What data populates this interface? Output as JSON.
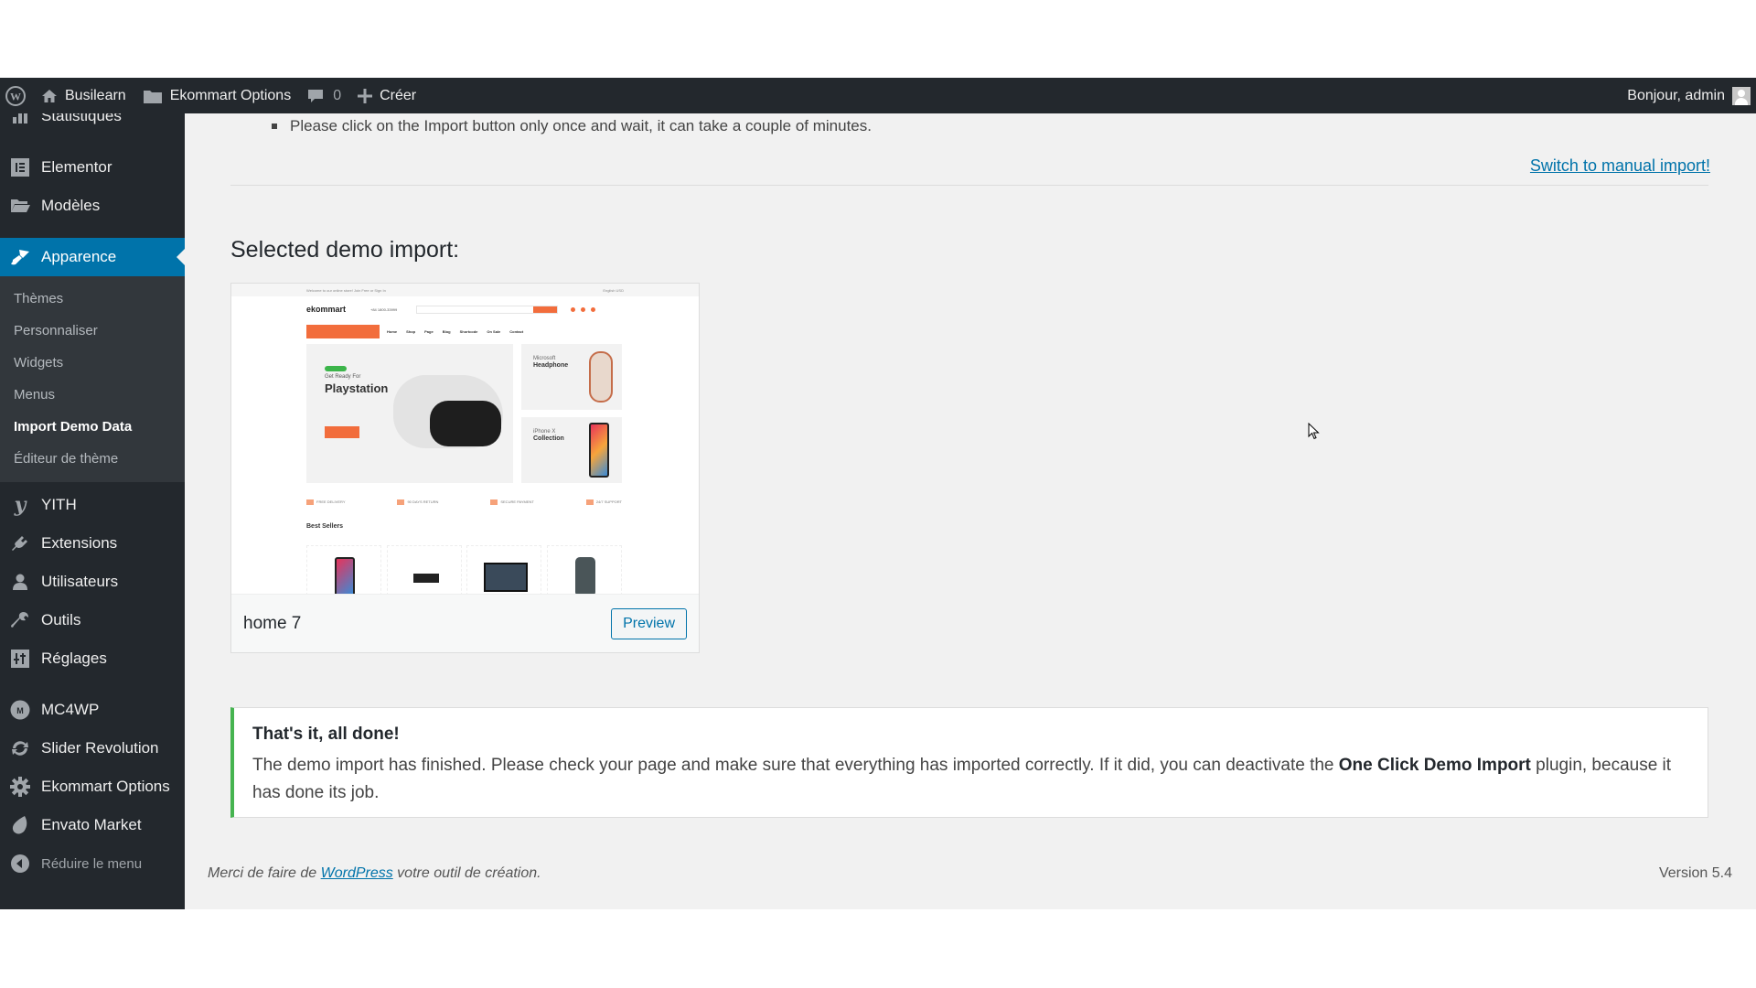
{
  "admin_bar": {
    "wp_logo_icon": "wordpress-logo-icon",
    "site_name": "Busilearn",
    "options_label": "Ekommart Options",
    "comments_count": "0",
    "new_label": "Créer",
    "greeting": "Bonjour, admin"
  },
  "sidebar": {
    "items_top": [
      {
        "label": "Statistiques",
        "icon": "stats-icon"
      },
      {
        "label": "Elementor",
        "icon": "elementor-icon"
      },
      {
        "label": "Modèles",
        "icon": "folder-icon"
      }
    ],
    "current": {
      "label": "Apparence",
      "icon": "brush-icon"
    },
    "submenu": [
      {
        "label": "Thèmes",
        "active": false
      },
      {
        "label": "Personnaliser",
        "active": false
      },
      {
        "label": "Widgets",
        "active": false
      },
      {
        "label": "Menus",
        "active": false
      },
      {
        "label": "Import Demo Data",
        "active": true
      },
      {
        "label": "Éditeur de thème",
        "active": false
      }
    ],
    "items_mid": [
      {
        "label": "YITH",
        "icon": "yith-icon"
      },
      {
        "label": "Extensions",
        "icon": "plugin-icon"
      },
      {
        "label": "Utilisateurs",
        "icon": "user-icon"
      },
      {
        "label": "Outils",
        "icon": "wrench-icon"
      },
      {
        "label": "Réglages",
        "icon": "settings-icon"
      }
    ],
    "items_bottom": [
      {
        "label": "MC4WP",
        "icon": "mc4wp-icon"
      },
      {
        "label": "Slider Revolution",
        "icon": "refresh-icon"
      },
      {
        "label": "Ekommart Options",
        "icon": "gear-icon"
      },
      {
        "label": "Envato Market",
        "icon": "leaf-icon"
      }
    ],
    "collapse_label": "Réduire le menu"
  },
  "main": {
    "note": "Please click on the Import button only once and wait, it can take a couple of minutes.",
    "manual_link": "Switch to manual import!",
    "section_title": "Selected demo import:",
    "demo": {
      "name": "home 7",
      "preview_label": "Preview",
      "screenshot": {
        "logo": "ekommart",
        "top_bar": "Welcome to our online store! Join Free or Sign In",
        "top_right": "English   USD",
        "phone": "+84 1800-33999",
        "nav": [
          "Home",
          "Shop",
          "Page",
          "Blog",
          "Shortcode",
          "On Sale",
          "Contact"
        ],
        "hero_label": "Get Ready For",
        "hero_title": "Playstation",
        "card1_line1": "Microsoft",
        "card1_line2": "Headphone",
        "card2_line1": "iPhone X",
        "card2_line2": "Collection",
        "features": [
          "FREE DELIVERY",
          "90 DAYS RETURN",
          "SECURE PAYMENT",
          "24/7 SUPPORT"
        ],
        "best_sellers": "Best Sellers"
      }
    },
    "notice": {
      "title": "That's it, all done!",
      "body_before": "The demo import has finished. Please check your page and make sure that everything has imported correctly. If it did, you can deactivate the ",
      "body_bold": "One Click Demo Import",
      "body_after": " plugin, because it has done its job.",
      "accent_color": "#46b450"
    }
  },
  "footer": {
    "thanks_before": "Merci de faire de ",
    "thanks_link": "WordPress",
    "thanks_after": " votre outil de création.",
    "version": "Version 5.4"
  },
  "colors": {
    "admin_bar": "#23282d",
    "sidebar": "#23282d",
    "current_menu": "#0073aa",
    "link": "#0073aa",
    "background": "#f1f1f1"
  }
}
